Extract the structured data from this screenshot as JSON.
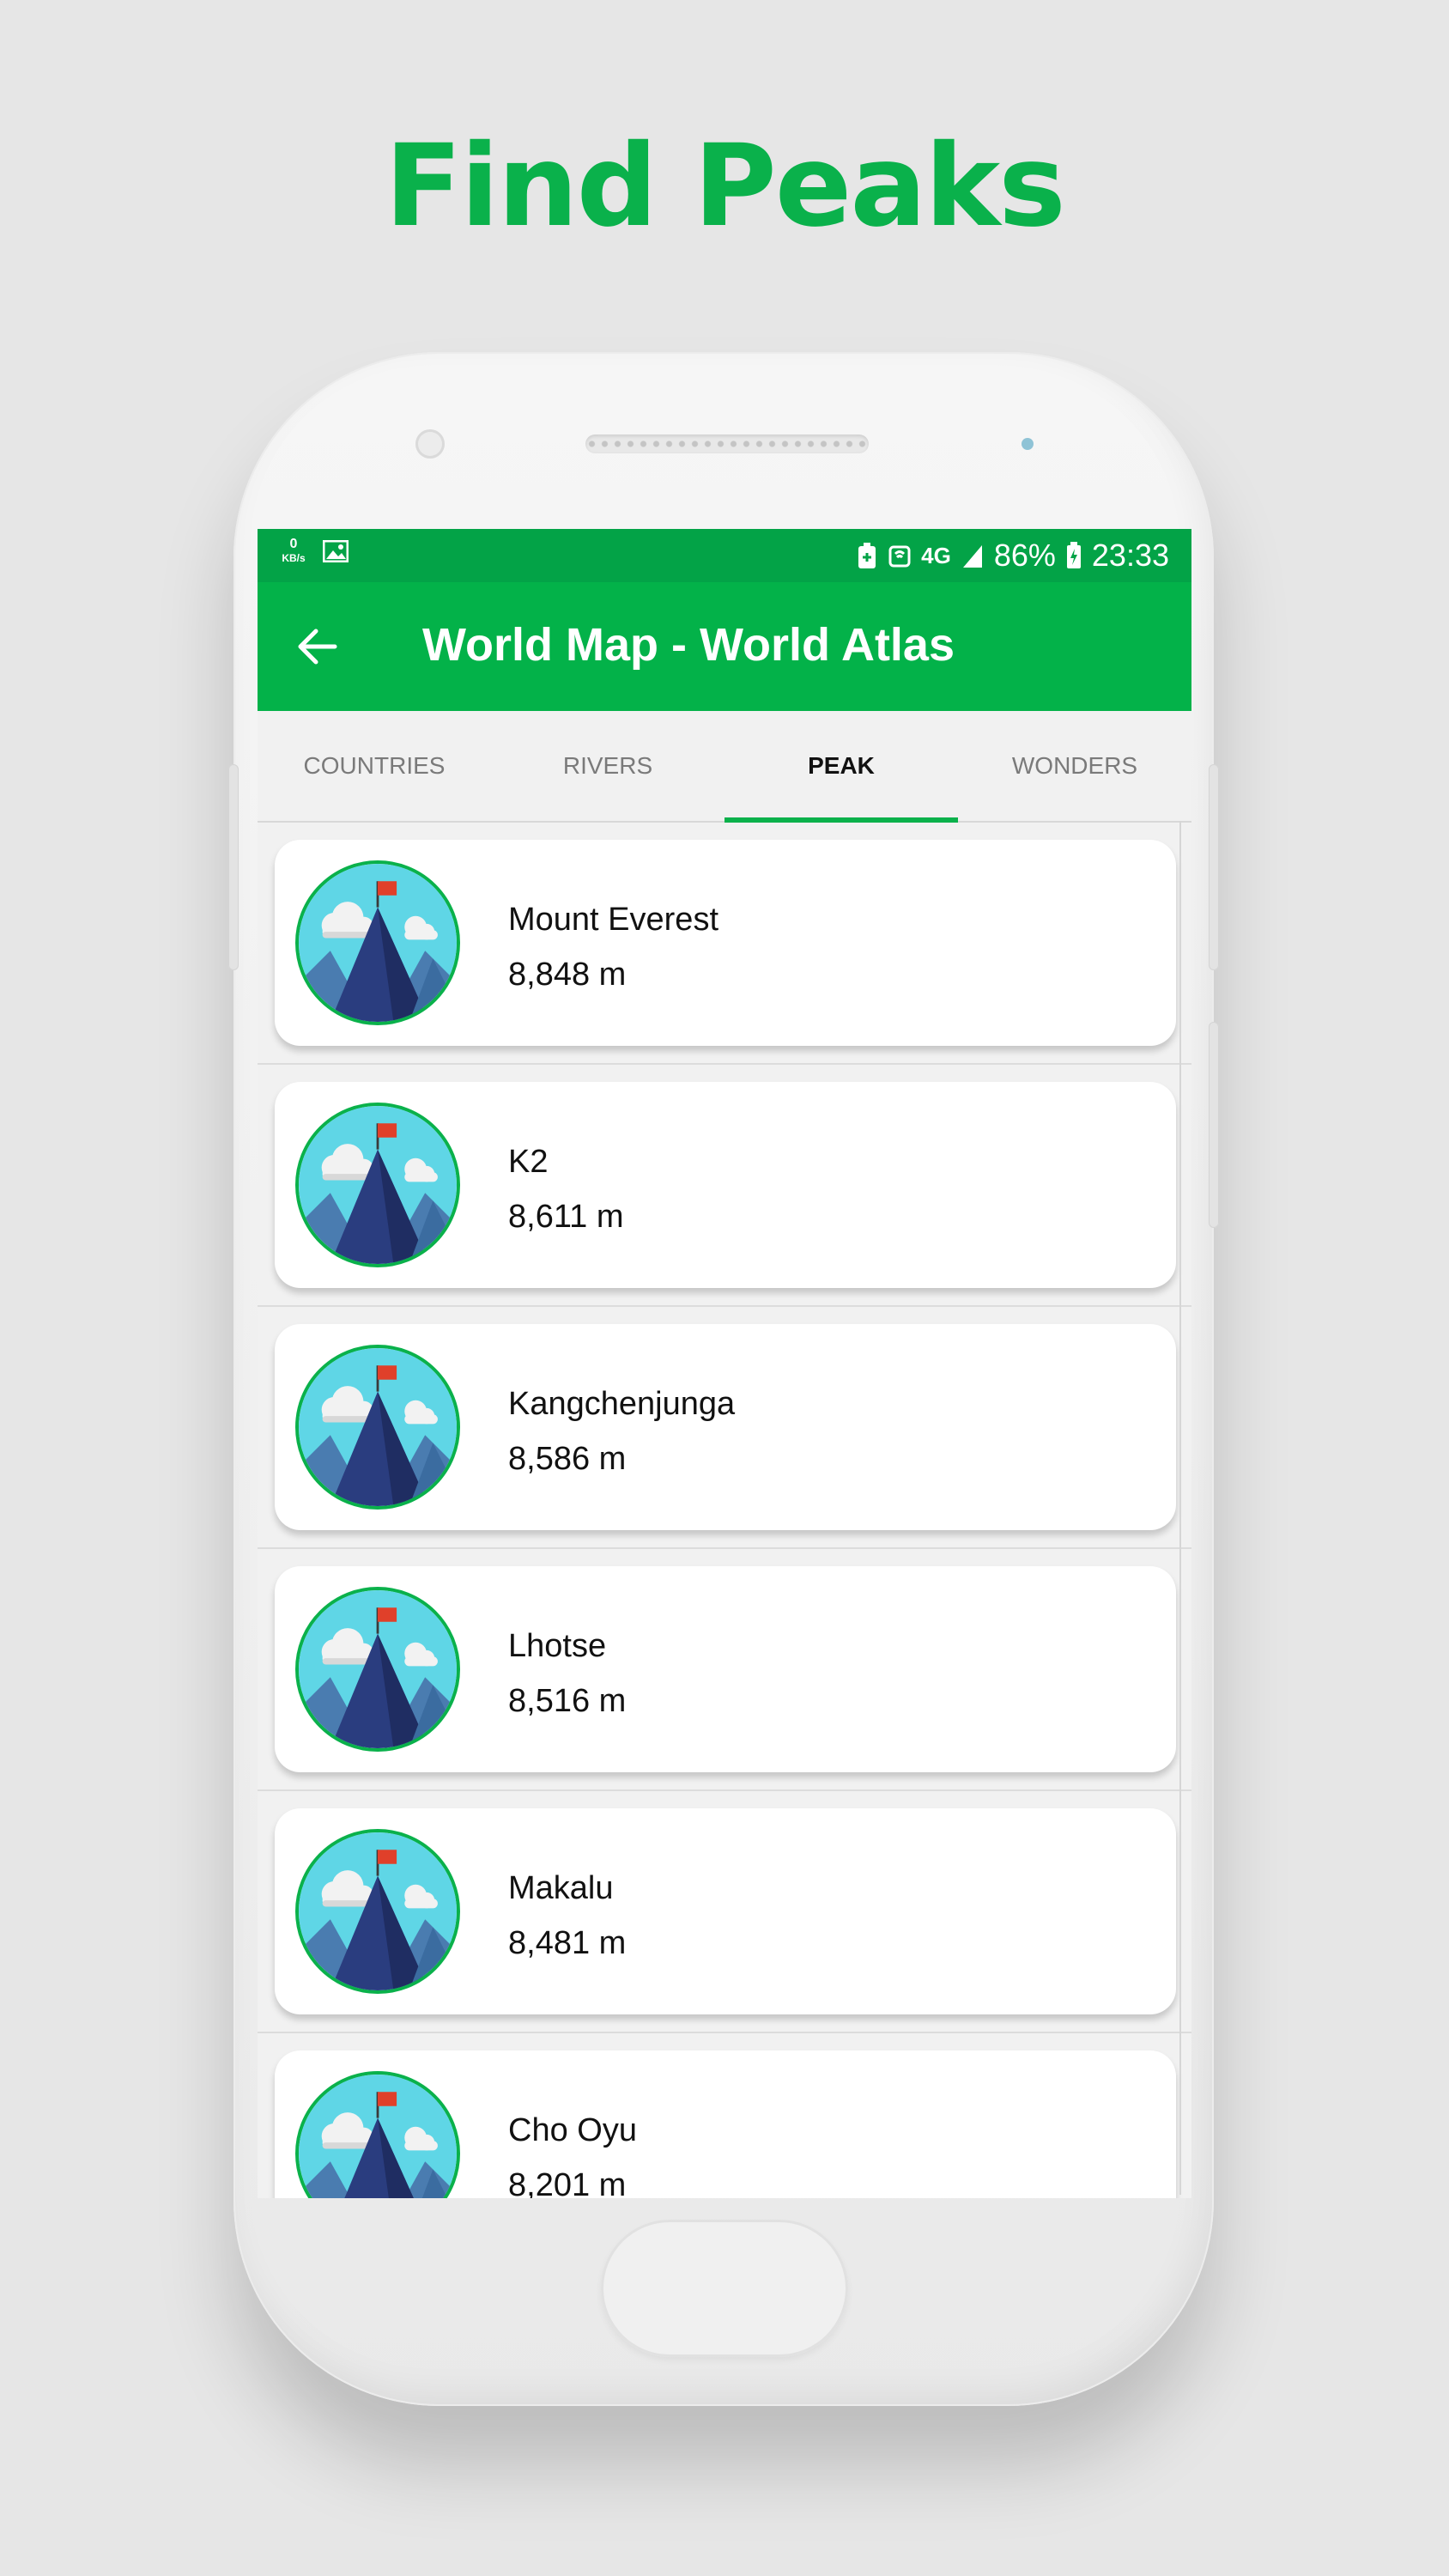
{
  "headline": "Find Peaks",
  "status_bar": {
    "kbs_value": "0",
    "kbs_unit": "KB/s",
    "network": "4G",
    "battery": "86%",
    "time": "23:33"
  },
  "app_bar": {
    "title": "World Map - World Atlas",
    "back_icon": "arrow-left-icon"
  },
  "tabs": [
    {
      "label": "COUNTRIES",
      "active": false
    },
    {
      "label": "RIVERS",
      "active": false
    },
    {
      "label": "PEAK",
      "active": true
    },
    {
      "label": "WONDERS",
      "active": false
    }
  ],
  "peaks": [
    {
      "name": "Mount Everest",
      "height": "8,848 m"
    },
    {
      "name": "K2",
      "height": "8,611 m"
    },
    {
      "name": "Kangchenjunga",
      "height": "8,586 m"
    },
    {
      "name": "Lhotse",
      "height": "8,516 m"
    },
    {
      "name": "Makalu",
      "height": "8,481 m"
    },
    {
      "name": "Cho Oyu",
      "height": "8,201 m"
    }
  ],
  "colors": {
    "brand_green": "#0ab14b",
    "status_green": "#03a347",
    "appbar_green": "#03b249"
  }
}
